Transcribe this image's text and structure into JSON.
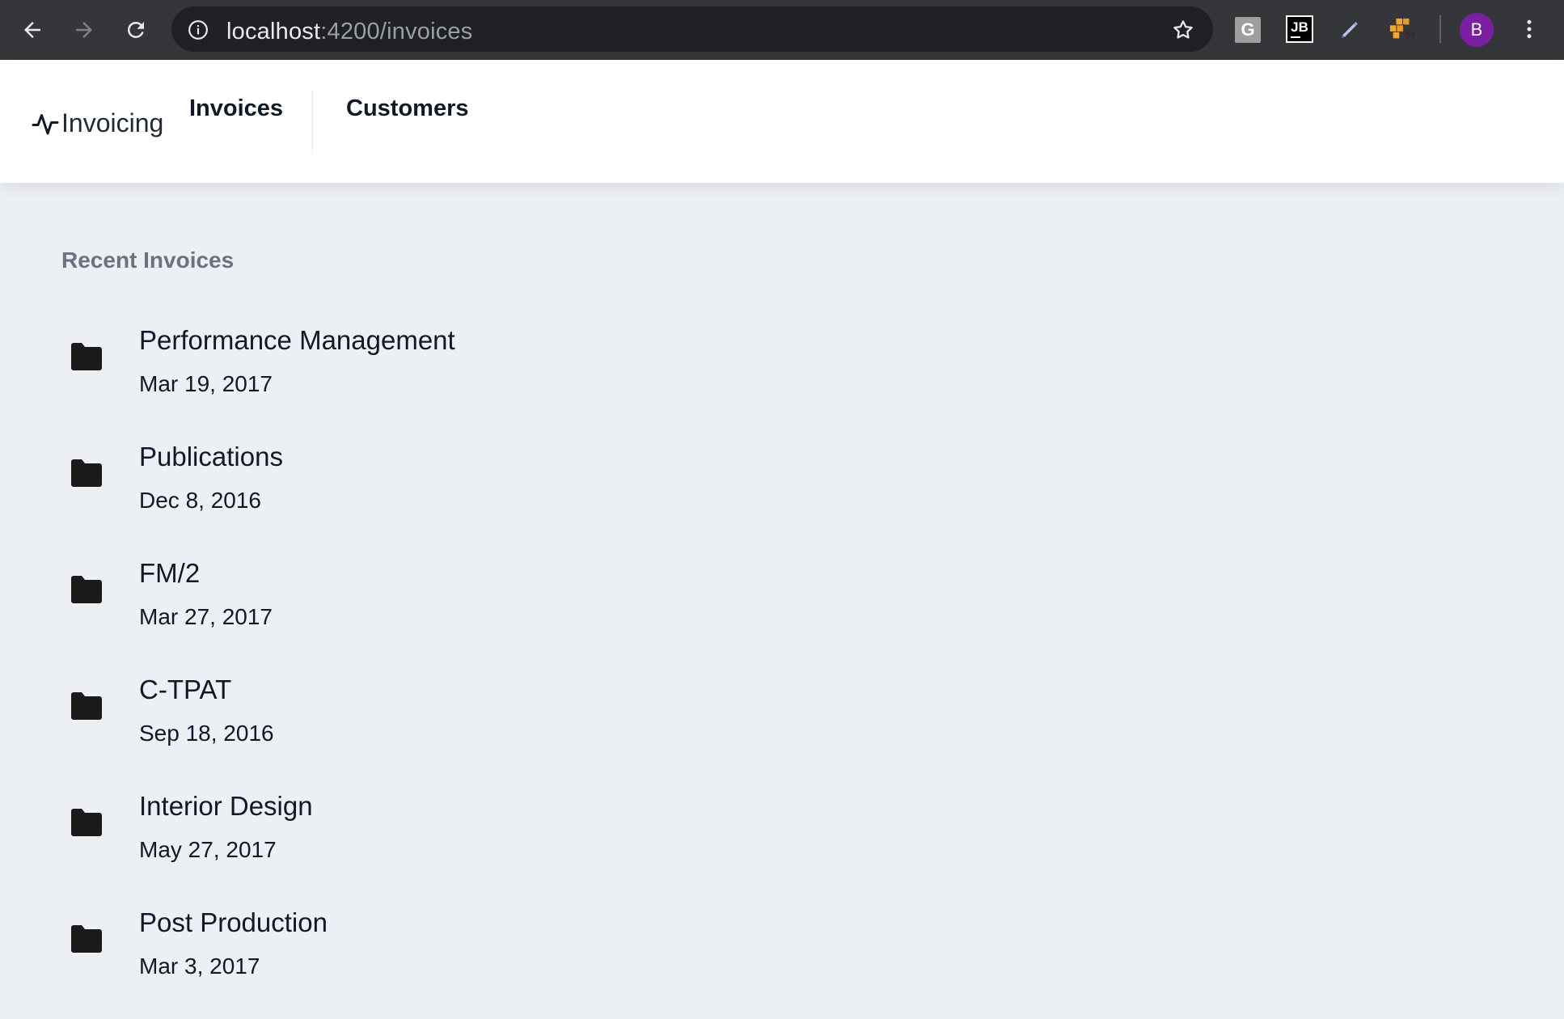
{
  "browser": {
    "url_host": "localhost",
    "url_path": ":4200/invoices",
    "extensions": [
      {
        "name": "grammarly-extension",
        "label": "G"
      },
      {
        "name": "jetbrains-extension",
        "label": "JB"
      },
      {
        "name": "pen-extension",
        "label": ""
      },
      {
        "name": "aws-extension",
        "label": ""
      }
    ],
    "profile_initial": "B",
    "profile_color": "#7b1fa2"
  },
  "header": {
    "brand": "Invoicing",
    "nav": [
      {
        "label": "Invoices"
      },
      {
        "label": "Customers"
      }
    ]
  },
  "main": {
    "section_title": "Recent Invoices",
    "invoices": [
      {
        "title": "Performance Management",
        "date": "Mar 19, 2017"
      },
      {
        "title": "Publications",
        "date": "Dec 8, 2016"
      },
      {
        "title": "FM/2",
        "date": "Mar 27, 2017"
      },
      {
        "title": "C-TPAT",
        "date": "Sep 18, 2016"
      },
      {
        "title": "Interior Design",
        "date": "May 27, 2017"
      },
      {
        "title": "Post Production",
        "date": "Mar 3, 2017"
      }
    ]
  }
}
